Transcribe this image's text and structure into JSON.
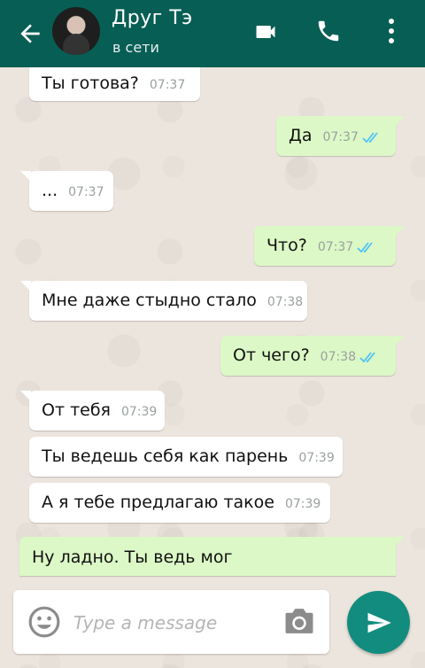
{
  "header": {
    "contact_name": "Друг Тэ",
    "status": "в сети",
    "colors": {
      "bar": "#075e54"
    },
    "icons": [
      "back-arrow-icon",
      "video-call-icon",
      "phone-icon",
      "more-vert-icon"
    ]
  },
  "messages": [
    {
      "direction": "in",
      "text": "Ты готова?",
      "time": "07:37"
    },
    {
      "direction": "out",
      "text": "Да",
      "time": "07:37",
      "read": true
    },
    {
      "direction": "in",
      "text": "...",
      "time": "07:37"
    },
    {
      "direction": "out",
      "text": "Что?",
      "time": "07:37",
      "read": true
    },
    {
      "direction": "in",
      "text": "Мне даже стыдно стало",
      "time": "07:38"
    },
    {
      "direction": "out",
      "text": "От чего?",
      "time": "07:38",
      "read": true
    },
    {
      "direction": "in",
      "text": "От тебя",
      "time": "07:39"
    },
    {
      "direction": "in",
      "text": "Ты ведешь себя как парень",
      "time": "07:39"
    },
    {
      "direction": "in",
      "text": "А я тебе предлагаю такое",
      "time": "07:39"
    },
    {
      "direction": "out",
      "text": "Ну ладно. Ты ведь мог",
      "time": ""
    }
  ],
  "composer": {
    "placeholder": "Type a message",
    "icons": [
      "emoji-icon",
      "camera-icon",
      "send-icon"
    ],
    "colors": {
      "send": "#128c7e",
      "outgoing": "#dcf8c6",
      "tick": "#4fc3f7"
    }
  }
}
